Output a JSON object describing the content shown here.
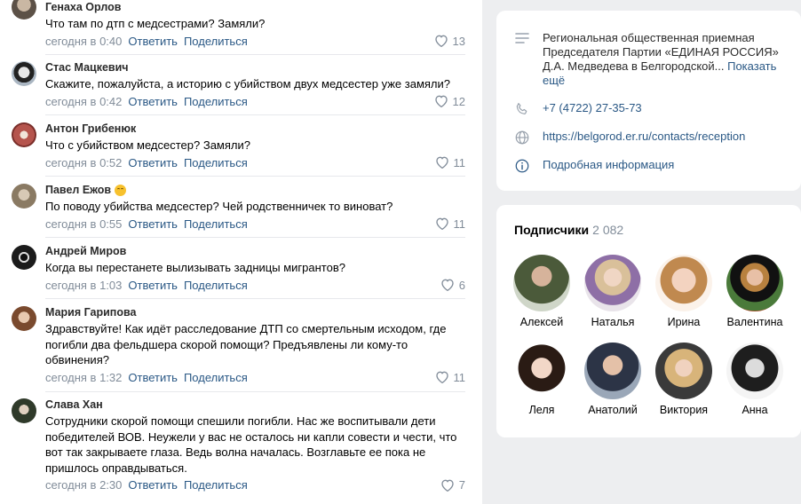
{
  "comments": [
    {
      "author": "Генаха Орлов",
      "text": "Что там по дтп с медсестрами? Замяли?",
      "date": "сегодня в 0:40",
      "likes": "13"
    },
    {
      "author": "Стас Мацкевич",
      "text": "Скажите, пожалуйста, а историю с убийством двух медсестер уже замяли?",
      "date": "сегодня в 0:42",
      "likes": "12"
    },
    {
      "author": "Антон Грибенюк",
      "text": "Что с убийством медсестер? Замяли?",
      "date": "сегодня в 0:52",
      "likes": "11"
    },
    {
      "author": "Павел Ежов",
      "text": "По поводу убийства медсестер? Чей родственничек то виноват?",
      "date": "сегодня в 0:55",
      "likes": "11"
    },
    {
      "author": "Андрей Миров",
      "text": "Когда вы перестанете вылизывать задницы мигрантов?",
      "date": "сегодня в 1:03",
      "likes": "6"
    },
    {
      "author": "Мария Гарипова",
      "text": "Здравствуйте! Как идёт расследование ДТП со смертельным исходом, где погибли два фельдшера скорой помощи? Предъявлены ли кому-то обвинения?",
      "date": "сегодня в 1:32",
      "likes": "11"
    },
    {
      "author": "Слава Хан",
      "text": "Сотрудники скорой помощи спешили погибли. Нас же воспитывали дети победителей ВОВ. Неужели у вас не осталось ни капли совести и чести, что вот так закрываете глаза. Ведь волна началась. Возглавьте ее пока не пришлось оправдываться.",
      "date": "сегодня в 2:30",
      "likes": "7"
    }
  ],
  "actions": {
    "reply": "Ответить",
    "share": "Поделиться"
  },
  "contacts": {
    "description": "Региональная общественная приемная Председателя Партии «ЕДИНАЯ РОССИЯ» Д.А. Медведева в Белгородской...",
    "show_more": "Показать ещё",
    "phone": "+7 (4722) 27-35-73",
    "website": "https://belgorod.er.ru/contacts/reception",
    "info": "Подробная информация"
  },
  "subscribers": {
    "title": "Подписчики",
    "count": "2 082",
    "people": [
      {
        "name": "Алексей"
      },
      {
        "name": "Наталья"
      },
      {
        "name": "Ирина"
      },
      {
        "name": "Валентина"
      },
      {
        "name": "Леля"
      },
      {
        "name": "Анатолий"
      },
      {
        "name": "Виктория"
      },
      {
        "name": "Анна"
      }
    ]
  },
  "colors": {
    "link": "#2a5885",
    "muted": "#818c99",
    "background": "#edeef0"
  }
}
